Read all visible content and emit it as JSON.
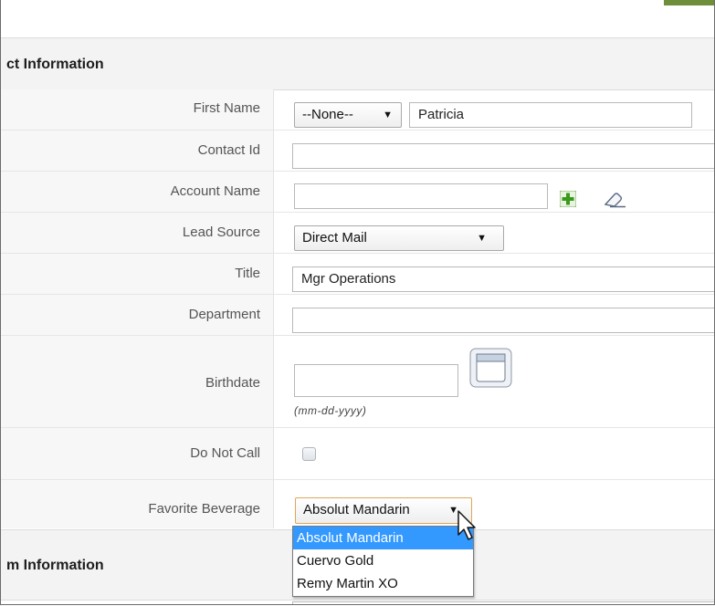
{
  "section_contact": {
    "title": "ct Information"
  },
  "section_system": {
    "title": "m Information"
  },
  "fields": {
    "first_name": {
      "label": "First Name",
      "salutation": "--None--",
      "value": "Patricia"
    },
    "contact_id": {
      "label": "Contact Id",
      "value": ""
    },
    "account_name": {
      "label": "Account Name",
      "value": ""
    },
    "lead_source": {
      "label": "Lead Source",
      "value": "Direct Mail"
    },
    "title": {
      "label": "Title",
      "value": "Mgr Operations"
    },
    "department": {
      "label": "Department",
      "value": ""
    },
    "birthdate": {
      "label": "Birthdate",
      "value": "",
      "format_hint": "(mm-dd-yyyy)"
    },
    "do_not_call": {
      "label": "Do Not Call",
      "checked": false
    },
    "favorite_beverage": {
      "label": "Favorite Beverage",
      "value": "Absolut Mandarin",
      "options": [
        "Absolut Mandarin",
        "Cuervo Gold",
        "Remy Martin XO"
      ],
      "highlighted_index": 0
    }
  },
  "icons": {
    "select_arrow": "▼",
    "add": "plus-icon",
    "clear": "eraser-icon",
    "calendar": "calendar-icon",
    "cursor": "mouse-pointer-icon"
  },
  "colors": {
    "accent": "#6f8e3c",
    "add_icon": "#3a9a1e",
    "highlight": "#3399ff"
  }
}
